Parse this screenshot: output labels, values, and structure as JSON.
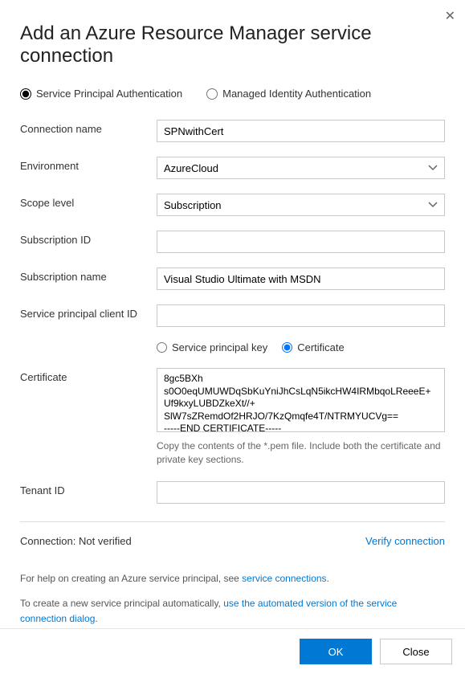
{
  "title": "Add an Azure Resource Manager service connection",
  "authRadios": {
    "spn": "Service Principal Authentication",
    "mi": "Managed Identity Authentication",
    "selected": "spn"
  },
  "fields": {
    "connectionName": {
      "label": "Connection name",
      "value": "SPNwithCert"
    },
    "environment": {
      "label": "Environment",
      "value": "AzureCloud"
    },
    "scopeLevel": {
      "label": "Scope level",
      "value": "Subscription"
    },
    "subscriptionId": {
      "label": "Subscription ID",
      "value": ""
    },
    "subscriptionName": {
      "label": "Subscription name",
      "value": "Visual Studio Ultimate with MSDN"
    },
    "spnClientId": {
      "label": "Service principal client ID",
      "value": ""
    },
    "certificate": {
      "label": "Certificate",
      "value": "8gc5BXh\ns0O0eqUMUWDqSbKuYniJhCsLqN5ikcHW4IRMbqoLReeeE+Uf9kxyLUBDZkeXt//+\nSlW7sZRemdOf2HRJO/7KzQmqfe4T/NTRMYUCVg==\n-----END CERTIFICATE-----",
      "help": "Copy the contents of the *.pem file. Include both the certificate and private key sections."
    },
    "tenantId": {
      "label": "Tenant ID",
      "value": ""
    }
  },
  "credRadios": {
    "key": "Service principal key",
    "cert": "Certificate",
    "selected": "cert"
  },
  "verify": {
    "labelPrefix": "Connection:",
    "status": "Not verified",
    "link": "Verify connection"
  },
  "help1": {
    "prefix": "For help on creating an Azure service principal, see ",
    "link": "service connections",
    "suffix": "."
  },
  "help2": {
    "prefix": "To create a new service principal automatically, ",
    "link": "use the automated version of the service connection dialog",
    "suffix": "."
  },
  "buttons": {
    "ok": "OK",
    "close": "Close"
  }
}
